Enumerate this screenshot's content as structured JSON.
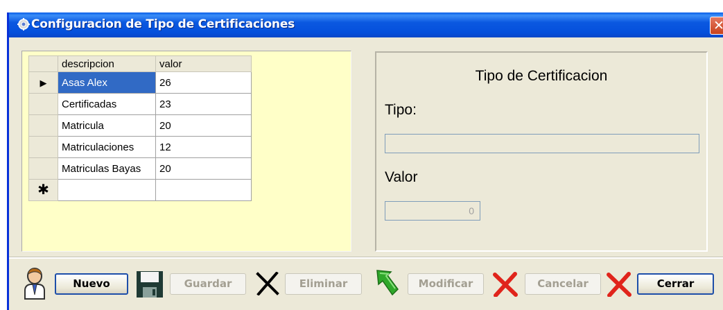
{
  "window": {
    "title": "Configuracion de Tipo de Certificaciones",
    "close_glyph": "✕"
  },
  "grid": {
    "columns": [
      "descripcion",
      "valor"
    ],
    "rows": [
      {
        "descripcion": "Asas Alex",
        "valor": "26",
        "indicator": "▶",
        "selected": true
      },
      {
        "descripcion": "Certificadas",
        "valor": "23"
      },
      {
        "descripcion": "Matricula",
        "valor": "20"
      },
      {
        "descripcion": "Matriculaciones",
        "valor": "12"
      },
      {
        "descripcion": "Matriculas Bayas",
        "valor": "20"
      }
    ],
    "new_row_marker": "✱"
  },
  "form": {
    "heading": "Tipo de Certificacion",
    "tipo_label": "Tipo:",
    "tipo_value": "",
    "valor_label": "Valor",
    "valor_value": "0"
  },
  "toolbar": {
    "nuevo": "Nuevo",
    "guardar": "Guardar",
    "eliminar": "Eliminar",
    "modificar": "Modificar",
    "cancelar": "Cancelar",
    "cerrar": "Cerrar"
  },
  "icons": {
    "title": "gear-icon",
    "nuevo": "user-icon",
    "guardar": "floppy-disk-icon",
    "eliminar": "x-mark-icon",
    "modificar": "green-arrow-icon",
    "cancelar": "red-x-icon",
    "cerrar": "red-x-icon"
  },
  "colors": {
    "titlebar": "#0550dc",
    "selection": "#316ac5",
    "grid_background": "#ffffc8",
    "window": "#ece9d8"
  }
}
